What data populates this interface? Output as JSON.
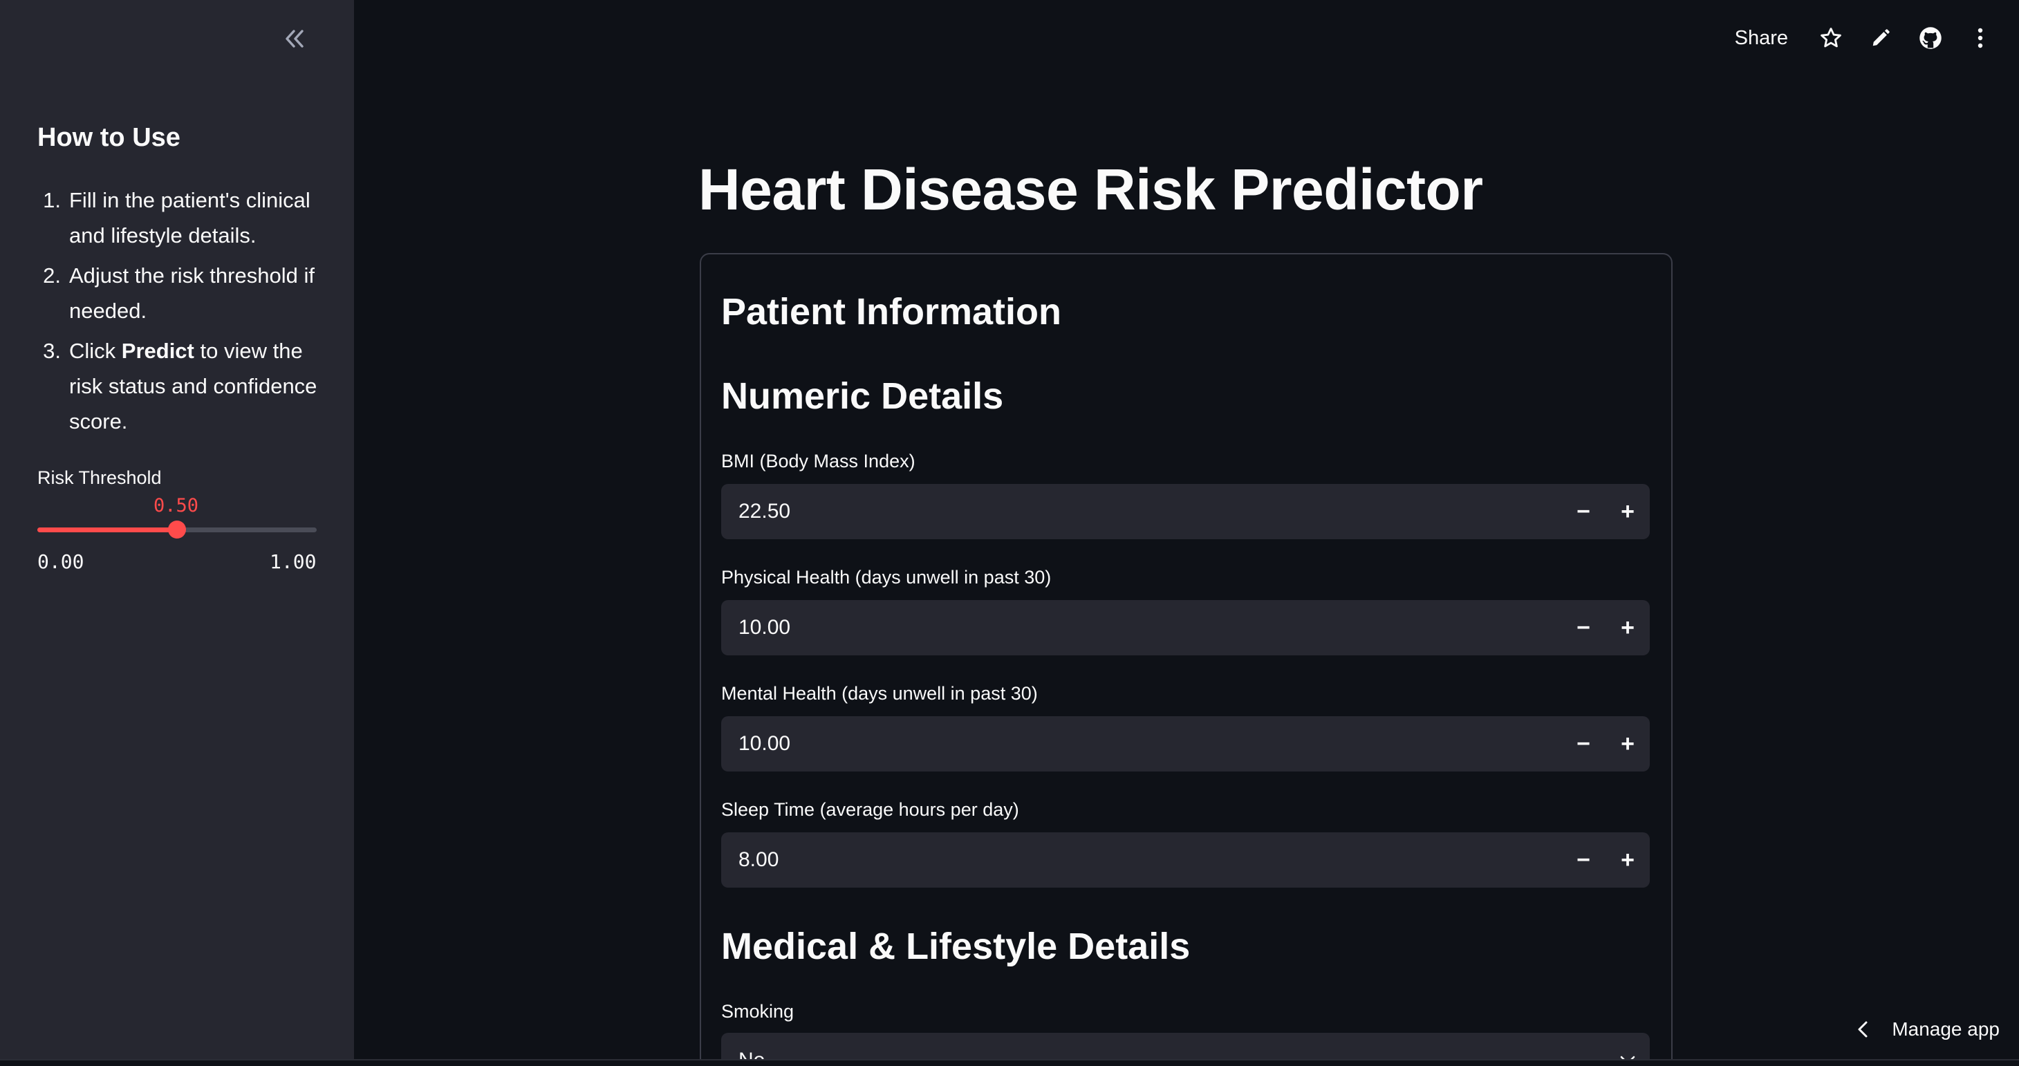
{
  "sidebar": {
    "title": "How to Use",
    "steps": [
      {
        "num": "1.",
        "before": "Fill in the patient's clinical and lifestyle details.",
        "bold": "",
        "after": ""
      },
      {
        "num": "2.",
        "before": "Adjust the risk threshold if needed.",
        "bold": "",
        "after": ""
      },
      {
        "num": "3.",
        "before": "Click ",
        "bold": "Predict",
        "after": " to view the risk status and confidence score."
      }
    ],
    "threshold": {
      "label": "Risk Threshold",
      "value": "0.50",
      "min": "0.00",
      "max": "1.00",
      "fraction": 0.5
    }
  },
  "toolbar": {
    "share_label": "Share",
    "icons": [
      "star-icon",
      "pencil-icon",
      "github-icon",
      "more-vertical-icon"
    ]
  },
  "main": {
    "title": "Heart Disease Risk Predictor",
    "card_heading": "Patient Information",
    "numeric_heading": "Numeric Details",
    "fields": [
      {
        "label": "BMI (Body Mass Index)",
        "value": "22.50"
      },
      {
        "label": "Physical Health (days unwell in past 30)",
        "value": "10.00"
      },
      {
        "label": "Mental Health (days unwell in past 30)",
        "value": "10.00"
      },
      {
        "label": "Sleep Time (average hours per day)",
        "value": "8.00"
      }
    ],
    "stepper_minus": "−",
    "stepper_plus": "+",
    "lifestyle_heading": "Medical & Lifestyle Details",
    "smoking": {
      "label": "Smoking",
      "value": "No"
    }
  },
  "footer": {
    "manage_app_label": "Manage app"
  },
  "colors": {
    "background": "#0e1117",
    "sidebar": "#262730",
    "input": "#262730",
    "accent": "#ff4b4b",
    "text": "#fafafa"
  }
}
